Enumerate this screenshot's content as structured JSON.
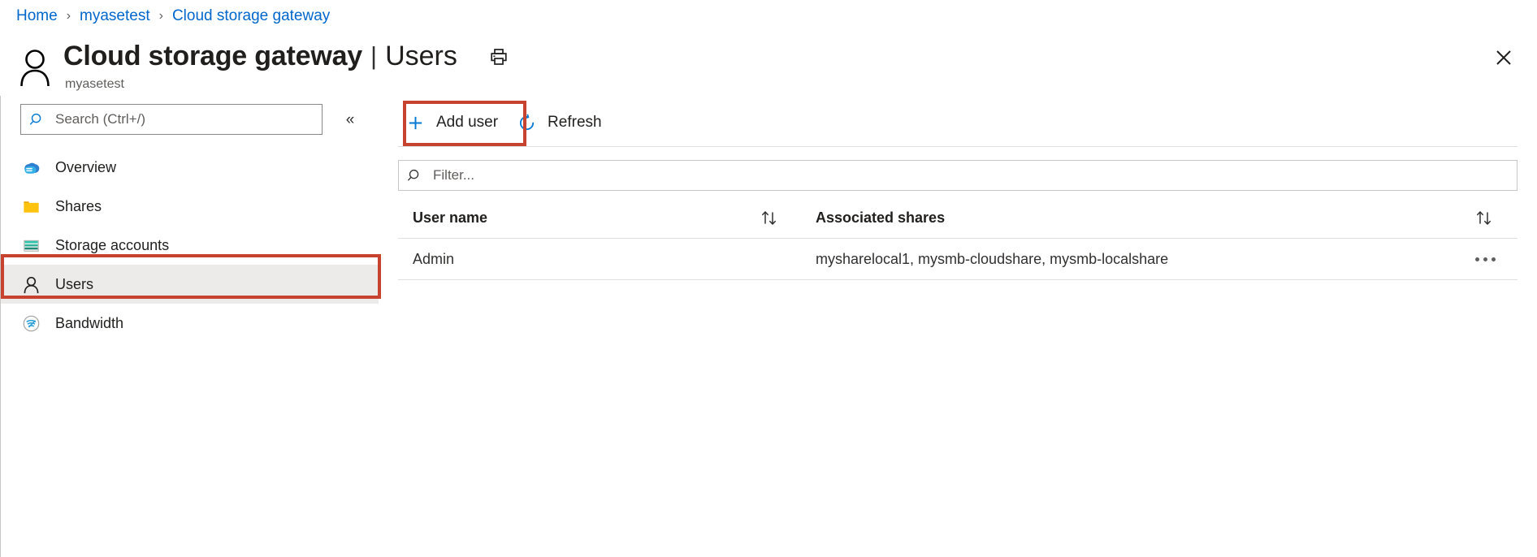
{
  "breadcrumb": {
    "items": [
      {
        "label": "Home"
      },
      {
        "label": "myasetest"
      },
      {
        "label": "Cloud storage gateway"
      }
    ],
    "separator": "›"
  },
  "header": {
    "avatar_icon": "person-icon",
    "title": "Cloud storage gateway",
    "title_separator": "|",
    "section": "Users",
    "subtitle": "myasetest",
    "print_icon": "printer-icon",
    "close_icon": "close-icon"
  },
  "sidebar": {
    "search": {
      "placeholder": "Search (Ctrl+/)",
      "value": "",
      "icon": "search-icon"
    },
    "collapse_icon": "«",
    "items": [
      {
        "label": "Overview",
        "icon": "cloud-icon",
        "selected": false
      },
      {
        "label": "Shares",
        "icon": "folder-icon",
        "selected": false
      },
      {
        "label": "Storage accounts",
        "icon": "storage-account-icon",
        "selected": false
      },
      {
        "label": "Users",
        "icon": "person-icon",
        "selected": true
      },
      {
        "label": "Bandwidth",
        "icon": "bandwidth-icon",
        "selected": false
      }
    ]
  },
  "toolbar": {
    "add_user_label": "Add user",
    "add_user_icon": "plus-icon",
    "refresh_label": "Refresh",
    "refresh_icon": "refresh-icon"
  },
  "filter": {
    "placeholder": "Filter...",
    "value": "",
    "icon": "search-icon"
  },
  "table": {
    "columns": [
      {
        "label": "User name",
        "sort_icon": "sort-arrows-icon"
      },
      {
        "label": "Associated shares",
        "sort_icon": "sort-arrows-icon"
      }
    ],
    "rows": [
      {
        "user_name": "Admin",
        "associated_shares": "mysharelocal1, mysmb-cloudshare, mysmb-localshare",
        "actions_icon": "more-options-icon"
      }
    ]
  },
  "annotations": {
    "highlight_color": "#c8432f",
    "targets": [
      "add-user-button",
      "sidebar-item-users"
    ]
  },
  "colors": {
    "link": "#0066cc",
    "accent": "#0078d4",
    "selected_bg": "#edebe9",
    "border": "#c8c6c4",
    "highlight": "#c8432f"
  }
}
